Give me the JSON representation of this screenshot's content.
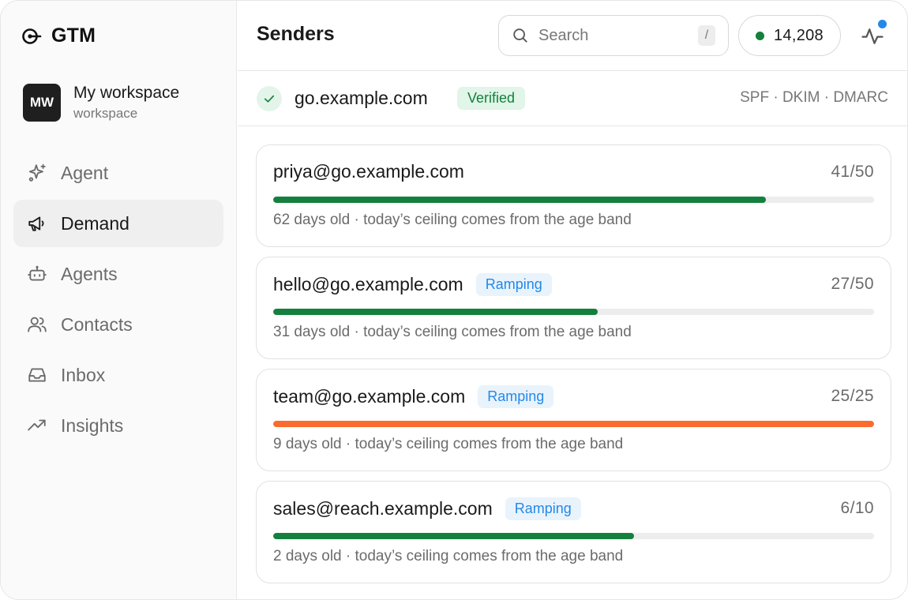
{
  "brand": {
    "name": "GTM"
  },
  "workspace": {
    "initials": "MW",
    "name": "My workspace",
    "subtitle": "workspace"
  },
  "nav": [
    {
      "label": "Agent",
      "icon": "sparkle-icon",
      "active": false
    },
    {
      "label": "Demand",
      "icon": "megaphone-icon",
      "active": true
    },
    {
      "label": "Agents",
      "icon": "bot-icon",
      "active": false
    },
    {
      "label": "Contacts",
      "icon": "users-icon",
      "active": false
    },
    {
      "label": "Inbox",
      "icon": "inbox-icon",
      "active": false
    },
    {
      "label": "Insights",
      "icon": "trending-up-icon",
      "active": false
    }
  ],
  "header": {
    "title": "Senders",
    "search_placeholder": "Search",
    "search_shortcut": "/",
    "credits": "14,208"
  },
  "domain": {
    "name": "go.example.com",
    "status": "Verified",
    "auth": "SPF · DKIM · DMARC"
  },
  "colors": {
    "progress_normal": "#15803d",
    "progress_full": "#fb6b2d",
    "verified_text": "#15803d",
    "ramping_text": "#2389e8"
  },
  "senders": [
    {
      "email": "priya@go.example.com",
      "badge": "",
      "count": "41/50",
      "fill_fraction": 0.82,
      "bar_color": "#15803d",
      "meta": "62 days old · today’s ceiling comes from the age band"
    },
    {
      "email": "hello@go.example.com",
      "badge": "Ramping",
      "count": "27/50",
      "fill_fraction": 0.54,
      "bar_color": "#15803d",
      "meta": "31 days old · today’s ceiling comes from the age band"
    },
    {
      "email": "team@go.example.com",
      "badge": "Ramping",
      "count": "25/25",
      "fill_fraction": 1.0,
      "bar_color": "#fb6b2d",
      "meta": "9 days old · today’s ceiling comes from the age band"
    },
    {
      "email": "sales@reach.example.com",
      "badge": "Ramping",
      "count": "6/10",
      "fill_fraction": 0.6,
      "bar_color": "#15803d",
      "meta": "2 days old · today’s ceiling comes from the age band"
    }
  ]
}
